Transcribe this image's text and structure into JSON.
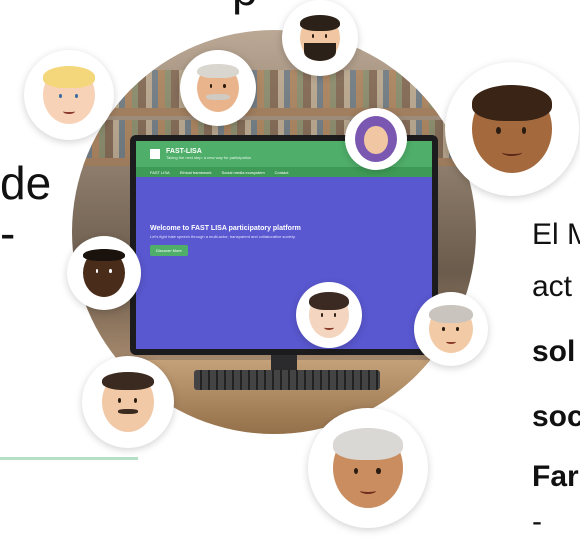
{
  "text_fragments": {
    "left_line_1": "de",
    "left_line_2": "-",
    "top_partial": "p"
  },
  "right_text": {
    "line1": "El M",
    "line2": "act",
    "line3": "sol",
    "line4": "soc",
    "line5": "Far",
    "line6": "-"
  },
  "monitor_screen": {
    "site_name": "FAST-LISA",
    "site_subtitle": "Taking the next step: a new way for participation",
    "nav_items": [
      "FAST LISA",
      "Ethical framework",
      "Social media ecosystem",
      "Contact"
    ],
    "hero_title": "Welcome to FAST LISA participatory platform",
    "hero_subtitle": "Let's fight hate speech through a multi-actor, transparent and collaborative society.",
    "cta_label": "Discover More"
  },
  "colors": {
    "accent_green": "#4faf6a",
    "screen_blue": "#5a58d0",
    "underline": "#b7dfc6"
  },
  "avatars": [
    {
      "name": "man-beard-icon"
    },
    {
      "name": "blond-child-icon"
    },
    {
      "name": "older-man-icon"
    },
    {
      "name": "hijab-woman-icon"
    },
    {
      "name": "woman-dark-skin-icon"
    },
    {
      "name": "man-dark-skin-icon"
    },
    {
      "name": "woman-dark-hair-icon"
    },
    {
      "name": "older-woman-icon"
    },
    {
      "name": "man-light-icon"
    },
    {
      "name": "grey-hair-person-icon"
    }
  ]
}
